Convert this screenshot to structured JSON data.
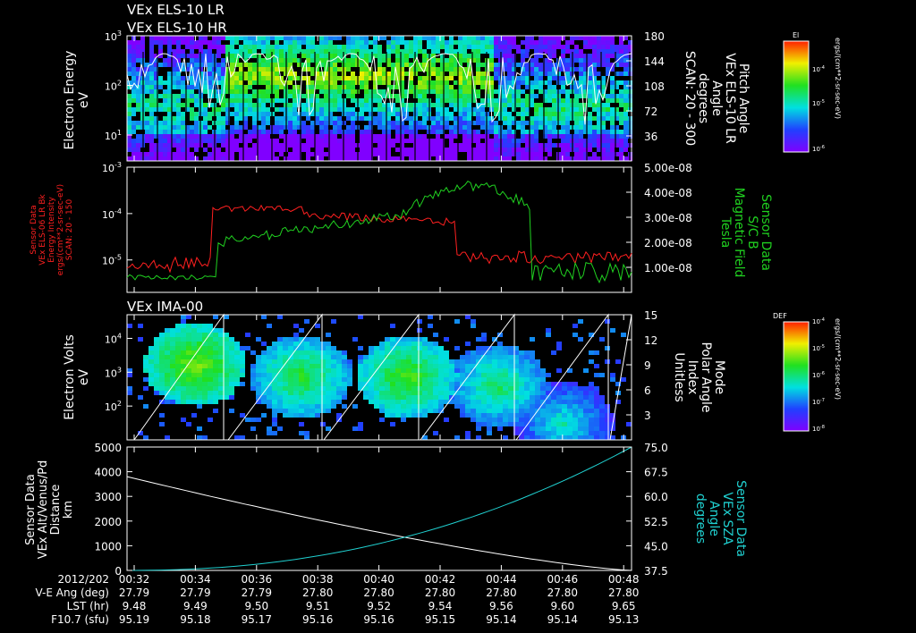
{
  "chart_data": [
    {
      "type": "heatmap",
      "titles": [
        "VEx ELS-10 LR",
        "VEx ELS-10 HR"
      ],
      "ylabel": "Electron Energy",
      "yunit": "eV",
      "y_scale": "log",
      "ylim": [
        3,
        1000
      ],
      "ytick_labels": [
        {
          "base": "10",
          "exp": "3",
          "value": 1000
        },
        {
          "base": "10",
          "exp": "2",
          "value": 100
        },
        {
          "base": "10",
          "exp": "1",
          "value": 10
        }
      ],
      "y2label": [
        "Pitch Angle",
        "VEx ELS-10 LR",
        "Angle",
        "degrees",
        "SCAN: 20 - 300"
      ],
      "y2lim": [
        0,
        180
      ],
      "y2_ticks": [
        "180",
        "144",
        "108",
        "72",
        "36"
      ],
      "colorbar": {
        "label": "El",
        "unit": "ergs/(cm**2-sr-sec-eV)",
        "tick_labels": [
          "10",
          "10",
          "10"
        ],
        "tick_exps": [
          "-4",
          "-5",
          "-6"
        ]
      }
    },
    {
      "type": "line",
      "ylabel_left": [
        "Sensor Data",
        "VEx ELS-06 LR Bk",
        "Energy Intensity",
        "ergs/(cm**2-sr-sec-eV)",
        "SCAN: 20 - 150"
      ],
      "y_scale": "log",
      "ylim": [
        2e-06,
        0.001
      ],
      "ytick_labels": [
        {
          "base": "10",
          "exp": "-3",
          "value": 0.001
        },
        {
          "base": "10",
          "exp": "-4",
          "value": 0.0001
        },
        {
          "base": "10",
          "exp": "-5",
          "value": 1e-05
        }
      ],
      "ylabel_right": [
        "Sensor Data",
        "S/C B",
        "Magnetic Field",
        "Tesla"
      ],
      "y2lim": [
        0,
        5e-08
      ],
      "y2_ticks": [
        "5.00e-08",
        "4.00e-08",
        "3.00e-08",
        "2.00e-08",
        "1.00e-08"
      ],
      "series_colors": {
        "energy": "#ff2020",
        "field": "#20d020"
      }
    },
    {
      "type": "heatmap",
      "title": "VEx IMA-00",
      "ylabel": "Electron Volts",
      "yunit": "eV",
      "y_scale": "log",
      "ylim": [
        10,
        50000
      ],
      "ytick_labels": [
        {
          "base": "10",
          "exp": "4",
          "value": 10000
        },
        {
          "base": "10",
          "exp": "3",
          "value": 1000
        },
        {
          "base": "10",
          "exp": "2",
          "value": 100
        }
      ],
      "y2label": [
        "Mode",
        "Polar Angle",
        "Index",
        "Unitless"
      ],
      "y2lim": [
        0,
        15
      ],
      "y2_ticks": [
        "15",
        "12",
        "9",
        "6",
        "3"
      ],
      "colorbar": {
        "label": "DEF",
        "unit": "ergs/(cm**2-sr-sec-eV)",
        "tick_labels": [
          "10",
          "10",
          "10",
          "10",
          "10"
        ],
        "tick_exps": [
          "-4",
          "-5",
          "-6",
          "-7",
          "-8"
        ]
      }
    },
    {
      "type": "line",
      "ylabel_left": [
        "Sensor Data",
        "VEx Alt/Venus/Pd",
        "Distance",
        "km"
      ],
      "ylim": [
        0,
        5000
      ],
      "y_ticks": [
        "5000",
        "4000",
        "3000",
        "2000",
        "1000",
        "0"
      ],
      "ylabel_right": [
        "Sensor Data",
        "VEx SZA",
        "Angle",
        "degrees"
      ],
      "y2lim": [
        37.5,
        75
      ],
      "y2_ticks": [
        "75.0",
        "67.5",
        "60.0",
        "52.5",
        "45.0",
        "37.5"
      ],
      "series": [
        {
          "color": "#ffffff",
          "x": [
            0,
            1
          ],
          "values": [
            3800,
            0
          ]
        },
        {
          "color": "#20d0d0",
          "x": [
            0,
            1
          ],
          "values": [
            37.5,
            75.0
          ]
        }
      ]
    }
  ],
  "time_axis": {
    "date": "2012/202",
    "ticks": [
      "00:32",
      "00:34",
      "00:36",
      "00:38",
      "00:40",
      "00:42",
      "00:44",
      "00:46",
      "00:48"
    ],
    "rows": [
      {
        "label": "V-E Ang (deg)",
        "values": [
          "27.79",
          "27.79",
          "27.79",
          "27.80",
          "27.80",
          "27.80",
          "27.80",
          "27.80",
          "27.80"
        ]
      },
      {
        "label": "LST (hr)",
        "values": [
          "9.48",
          "9.49",
          "9.50",
          "9.51",
          "9.52",
          "9.54",
          "9.56",
          "9.60",
          "9.65"
        ]
      },
      {
        "label": "F10.7 (sfu)",
        "values": [
          "95.19",
          "95.18",
          "95.17",
          "95.16",
          "95.16",
          "95.15",
          "95.14",
          "95.14",
          "95.13"
        ]
      }
    ]
  },
  "colors": {
    "background": "#000000",
    "axes": "#ffffff",
    "red_label": "#ff2020",
    "green_label": "#20d020",
    "cyan_label": "#20d0d0"
  }
}
